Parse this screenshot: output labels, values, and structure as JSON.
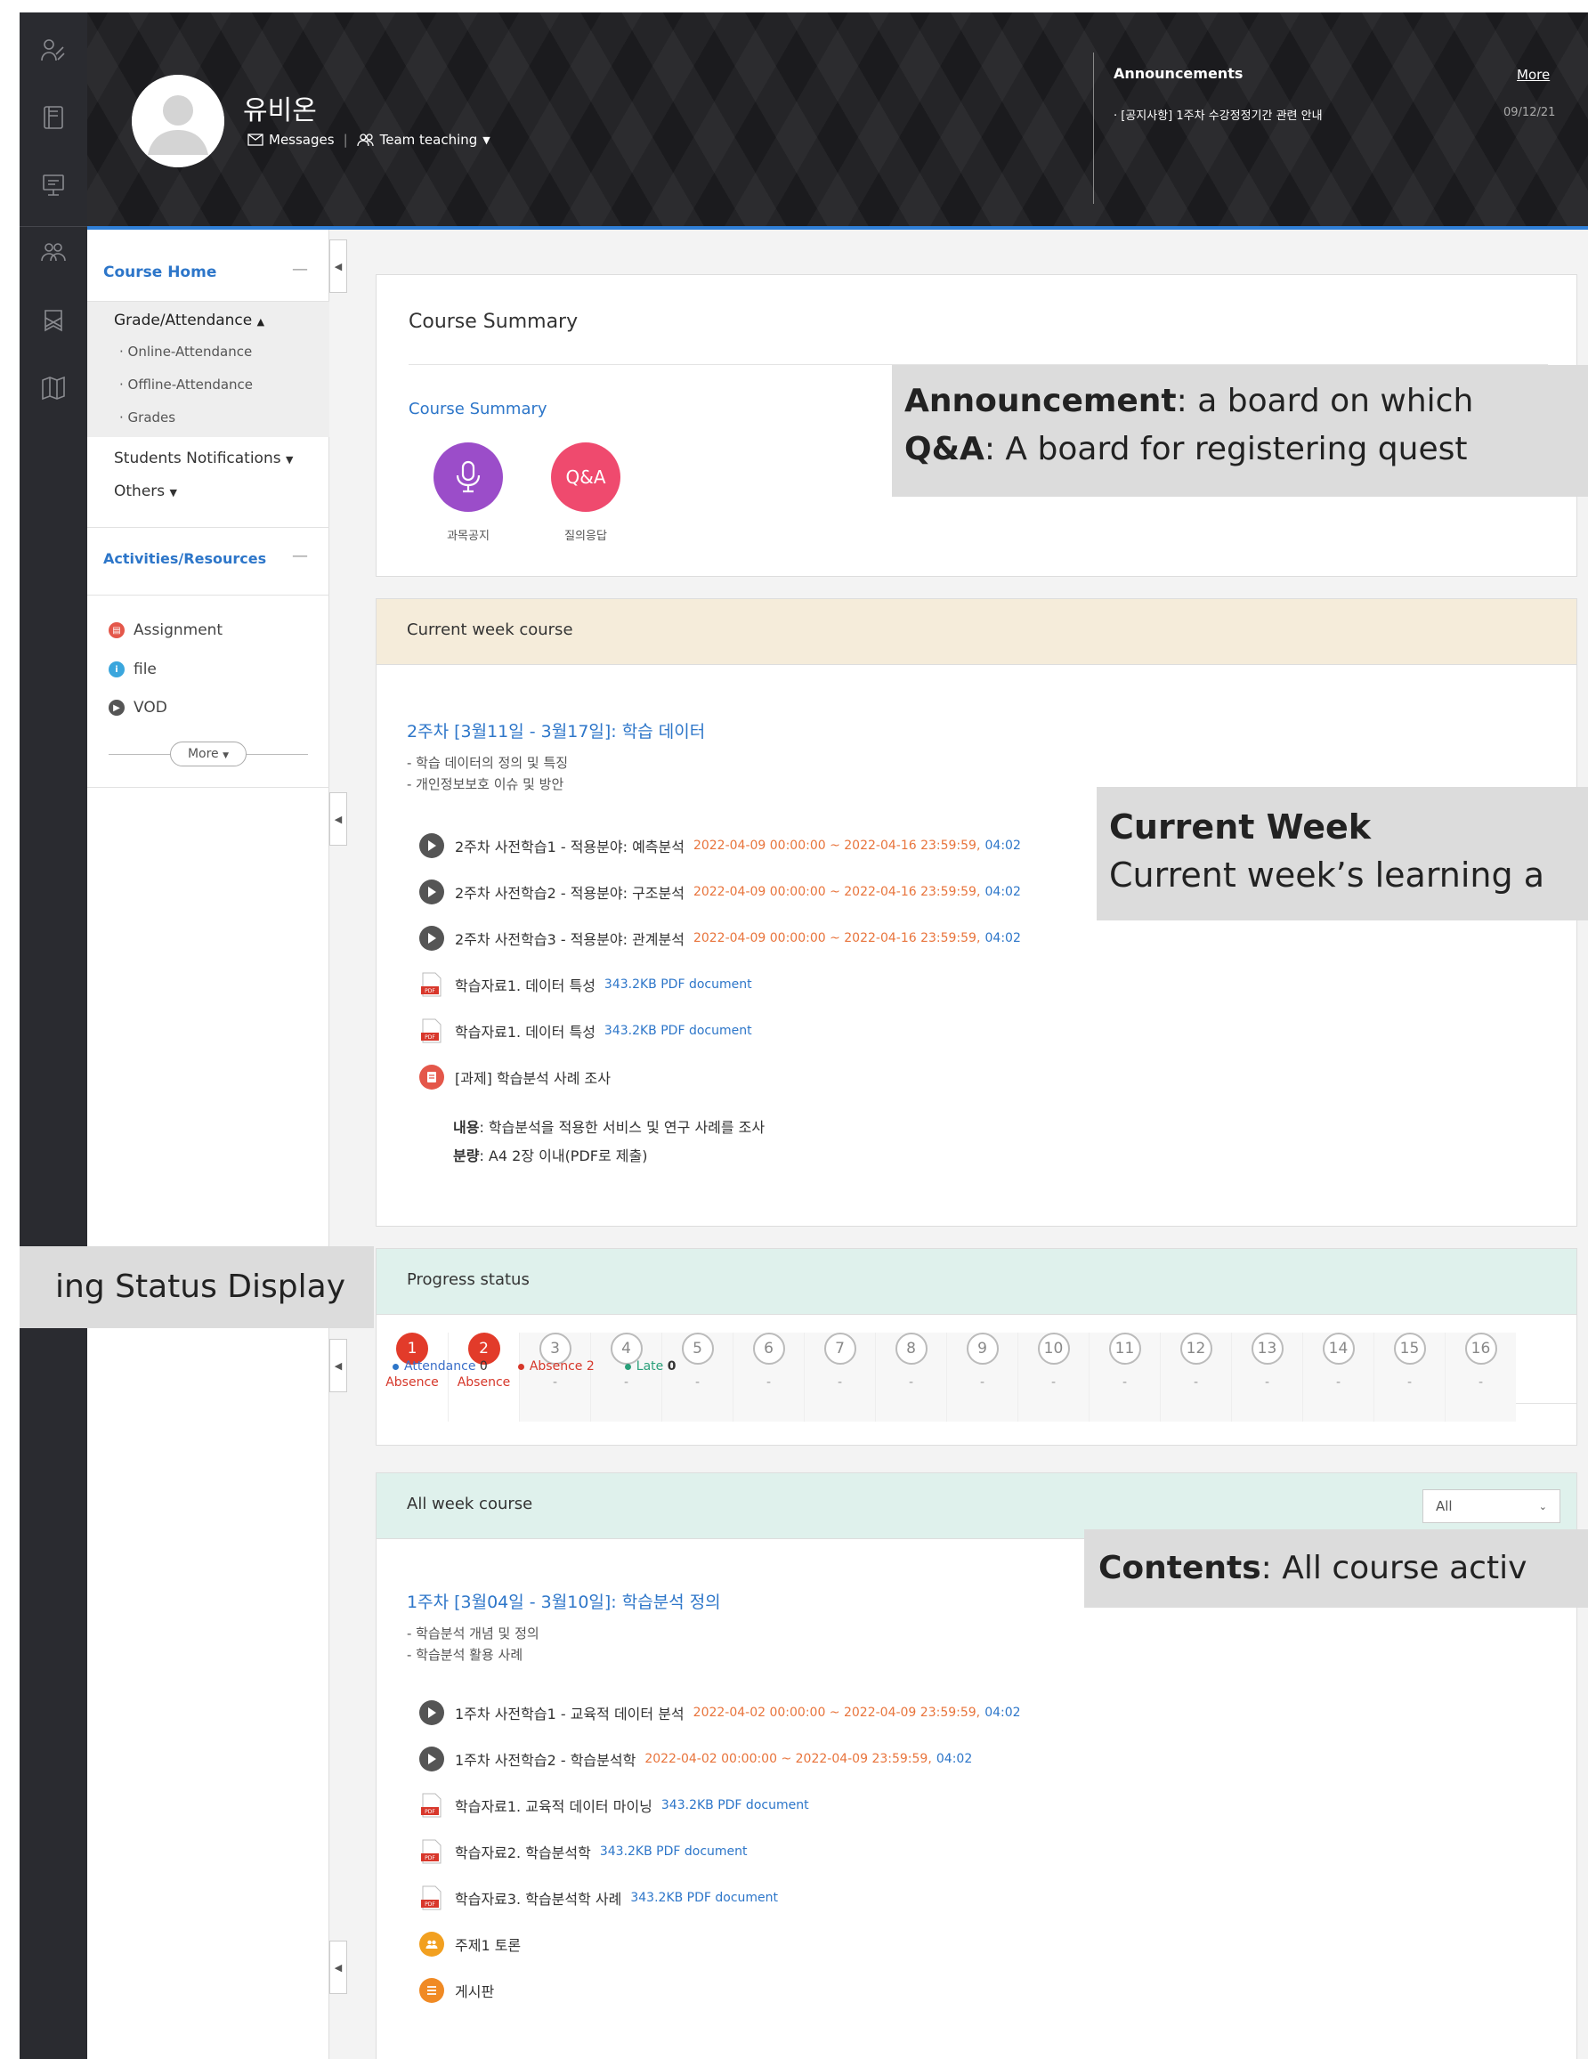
{
  "rail": {
    "icons": [
      "users-icon",
      "book-icon",
      "monitor-icon",
      "group-icon",
      "pass-icon",
      "map-icon"
    ]
  },
  "header": {
    "user_name": "유비온",
    "messages": "Messages",
    "team_teaching": "Team teaching",
    "announcements": {
      "title": "Announcements",
      "more": "More",
      "item": "· [공지사항] 1주차 수강정정기간 관련 안내",
      "date": "09/12/21"
    }
  },
  "sidebar": {
    "course_home": "Course Home",
    "grade_attendance": "Grade/Attendance",
    "subs": [
      "· Online-Attendance",
      "· Offline-Attendance",
      "· Grades"
    ],
    "students_notifications": "Students Notifications",
    "others": "Others",
    "activities": "Activities/Resources",
    "resources": [
      "Assignment",
      "file",
      "VOD"
    ],
    "more": "More"
  },
  "summary": {
    "title": "Course Summary",
    "link": "Course Summary",
    "qa_label": "Q&A",
    "icon_labels": [
      "과목공지",
      "질의응답"
    ]
  },
  "current_week": {
    "header": "Current week course",
    "title": "2주차 [3월11일 - 3월17일]: 학습 데이터",
    "desc": [
      "- 학습 데이터의 정의 및 특징",
      "- 개인정보보호 이슈 및 방안"
    ],
    "videos": [
      {
        "name": "2주차 사전학습1 - 적용분야: 예측분석",
        "date": "2022-04-09 00:00:00 ~ 2022-04-16 23:59:59,",
        "dur": "04:02"
      },
      {
        "name": "2주차 사전학습2 - 적용분야: 구조분석",
        "date": "2022-04-09 00:00:00 ~ 2022-04-16 23:59:59,",
        "dur": "04:02"
      },
      {
        "name": "2주차 사전학습3 - 적용분야: 관계분석",
        "date": "2022-04-09 00:00:00 ~ 2022-04-16 23:59:59,",
        "dur": "04:02"
      }
    ],
    "files": [
      {
        "name": "학습자료1. 데이터 특성",
        "meta": "343.2KB PDF document"
      },
      {
        "name": "학습자료1. 데이터 특성",
        "meta": "343.2KB PDF document"
      }
    ],
    "assignment": "[과제] 학습분석 사례 조사",
    "content_label": "내용",
    "content_text": ": 학습분석을 적용한 서비스 및 연구 사례를 조사",
    "amount_label": "분량",
    "amount_text": ": A4 2장 이내(PDF로 제출)"
  },
  "progress": {
    "header": "Progress status",
    "weeks": [
      {
        "n": "1",
        "status": "Absence"
      },
      {
        "n": "2",
        "status": "Absence"
      },
      {
        "n": "3",
        "status": "-"
      },
      {
        "n": "4",
        "status": "-"
      },
      {
        "n": "5",
        "status": "-"
      },
      {
        "n": "6",
        "status": "-"
      },
      {
        "n": "7",
        "status": "-"
      },
      {
        "n": "8",
        "status": "-"
      },
      {
        "n": "9",
        "status": "-"
      },
      {
        "n": "10",
        "status": "-"
      },
      {
        "n": "11",
        "status": "-"
      },
      {
        "n": "12",
        "status": "-"
      },
      {
        "n": "13",
        "status": "-"
      },
      {
        "n": "14",
        "status": "-"
      },
      {
        "n": "15",
        "status": "-"
      },
      {
        "n": "16",
        "status": "-"
      }
    ],
    "legend": {
      "attendance": "Attendance",
      "attendance_n": "0",
      "absence": "Absence",
      "absence_n": "2",
      "late": "Late",
      "late_n": "0"
    }
  },
  "all_week": {
    "header": "All week course",
    "select": "All",
    "title": "1주차 [3월04일 - 3월10일]: 학습분석 정의",
    "desc": [
      "- 학습분석 개념 및 정의",
      "- 학습분석 활용 사례"
    ],
    "videos": [
      {
        "name": "1주차 사전학습1 - 교육적 데이터 분석",
        "date": "2022-04-02 00:00:00 ~ 2022-04-09 23:59:59,",
        "dur": "04:02"
      },
      {
        "name": "1주차 사전학습2 - 학습분석학",
        "date": "2022-04-02 00:00:00 ~ 2022-04-09 23:59:59,",
        "dur": "04:02"
      }
    ],
    "files": [
      {
        "name": "학습자료1. 교육적 데이터 마이닝",
        "meta": "343.2KB PDF document"
      },
      {
        "name": "학습자료2. 학습분석학",
        "meta": "343.2KB PDF document"
      },
      {
        "name": "학습자료3. 학습분석학 사례",
        "meta": "343.2KB PDF document"
      }
    ],
    "discussion": "주제1 토론",
    "board": "게시판"
  },
  "overlays": {
    "ann_bold": "Announcement",
    "ann_text": ": a board on which",
    "qa_bold": "Q&A",
    "qa_text": ": A board for registering quest",
    "cw_bold": "Current Week",
    "cw_text": "Current week’s learning a",
    "status": "ing Status Display",
    "contents_bold": "Contents",
    "contents_text": ": All course activ"
  }
}
